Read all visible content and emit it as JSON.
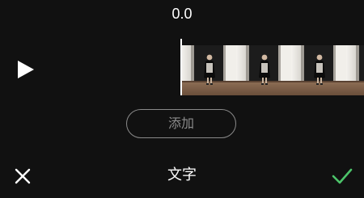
{
  "player": {
    "current_time": "0.0",
    "play_icon": "play-icon"
  },
  "timeline": {
    "frame_count": 4
  },
  "actions": {
    "add_label": "添加"
  },
  "bottom_bar": {
    "title": "文字",
    "close_icon": "close-icon",
    "confirm_icon": "check-icon"
  },
  "colors": {
    "background": "#111111",
    "accent_check": "#4cc46a",
    "button_border": "#8a8a8a",
    "button_text": "#8c8c8c",
    "primary_text": "#ffffff"
  }
}
